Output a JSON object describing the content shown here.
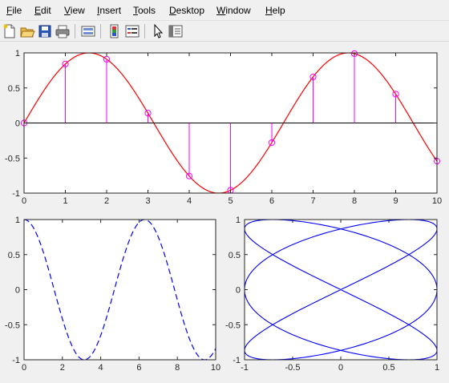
{
  "menu": {
    "items": [
      {
        "label": "File",
        "accel": "F",
        "rest": "ile"
      },
      {
        "label": "Edit",
        "accel": "E",
        "rest": "dit"
      },
      {
        "label": "View",
        "accel": "V",
        "rest": "iew"
      },
      {
        "label": "Insert",
        "accel": "I",
        "rest": "nsert"
      },
      {
        "label": "Tools",
        "accel": "T",
        "rest": "ools"
      },
      {
        "label": "Desktop",
        "accel": "D",
        "rest": "esktop"
      },
      {
        "label": "Window",
        "accel": "W",
        "rest": "indow"
      },
      {
        "label": "Help",
        "accel": "H",
        "rest": "elp"
      }
    ]
  },
  "toolbar": {
    "icons": [
      "new-file-icon",
      "open-folder-icon",
      "save-icon",
      "print-icon",
      "link-plot-icon",
      "insert-colorbar-icon",
      "insert-legend-icon",
      "edit-plot-pointer-icon",
      "property-inspector-icon"
    ]
  },
  "chart_data": [
    {
      "type": "line",
      "description_series": [
        {
          "kind": "line",
          "color": "#ff0000",
          "function": "sin(x)",
          "x_range": [
            0,
            10
          ]
        },
        {
          "kind": "stem",
          "color": "#ff00ff",
          "marker": "circle",
          "x": [
            0,
            1,
            2,
            3,
            4,
            5,
            6,
            7,
            8,
            9,
            10
          ],
          "y": [
            0,
            0.8415,
            0.9093,
            0.1411,
            -0.7568,
            -0.9589,
            -0.2794,
            0.657,
            0.9894,
            0.4121,
            -0.544
          ]
        }
      ],
      "xlim": [
        0,
        10
      ],
      "ylim": [
        -1,
        1
      ],
      "xticks": [
        "0",
        "1",
        "2",
        "3",
        "4",
        "5",
        "6",
        "7",
        "8",
        "9",
        "10"
      ],
      "yticks": [
        "-1",
        "-0.5",
        "0",
        "0.5",
        "1"
      ],
      "title": "",
      "xlabel": "",
      "ylabel": "",
      "baseline": 0
    },
    {
      "type": "line",
      "description_series": [
        {
          "kind": "line",
          "style": "dashed",
          "color": "#0000ff",
          "function": "cos(x)",
          "x_range": [
            0,
            10
          ]
        }
      ],
      "xlim": [
        0,
        10
      ],
      "ylim": [
        -1,
        1
      ],
      "xticks": [
        "0",
        "2",
        "4",
        "6",
        "8",
        "10"
      ],
      "yticks": [
        "-1",
        "-0.5",
        "0",
        "0.5",
        "1"
      ],
      "title": "",
      "xlabel": "",
      "ylabel": ""
    },
    {
      "type": "line",
      "description_series": [
        {
          "kind": "parametric",
          "color": "#0000ff",
          "x_function": "sin(3t)",
          "y_function": "sin(2t)",
          "t_range": [
            0,
            6.2832
          ]
        }
      ],
      "xlim": [
        -1,
        1
      ],
      "ylim": [
        -1,
        1
      ],
      "xticks": [
        "-1",
        "-0.5",
        "0",
        "0.5",
        "1"
      ],
      "yticks": [
        "-1",
        "-0.5",
        "0",
        "0.5",
        "1"
      ],
      "title": "",
      "xlabel": "",
      "ylabel": ""
    }
  ]
}
